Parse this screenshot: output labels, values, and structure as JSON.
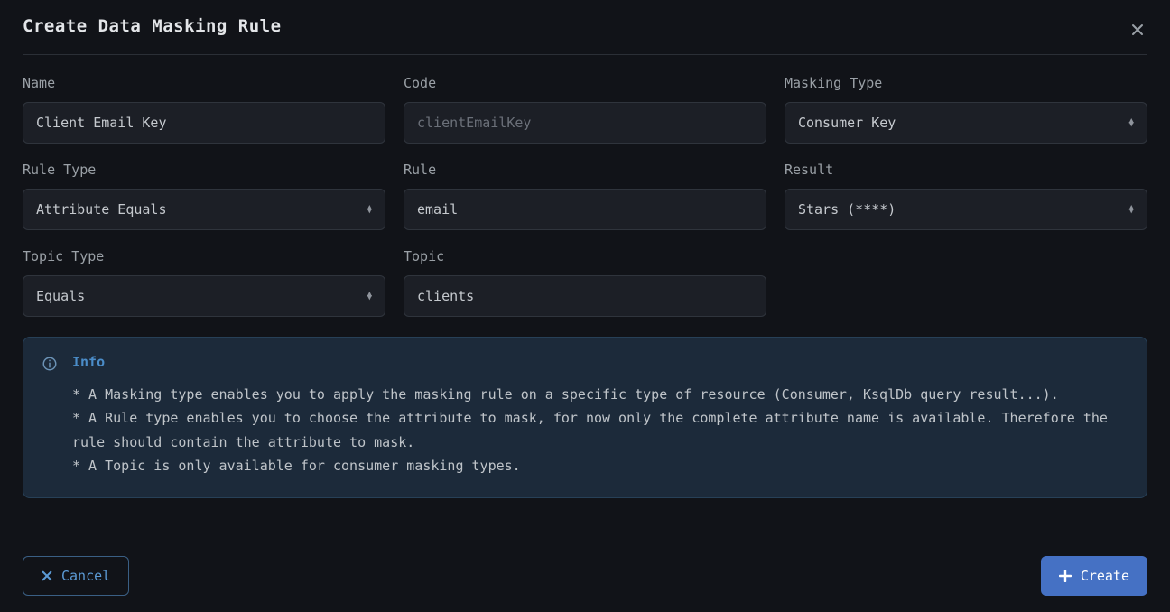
{
  "modal": {
    "title": "Create Data Masking Rule"
  },
  "fields": {
    "name": {
      "label": "Name",
      "value": "Client Email Key"
    },
    "code": {
      "label": "Code",
      "placeholder": "clientEmailKey",
      "value": ""
    },
    "maskingType": {
      "label": "Masking Type",
      "value": "Consumer Key"
    },
    "ruleType": {
      "label": "Rule Type",
      "value": "Attribute Equals"
    },
    "rule": {
      "label": "Rule",
      "value": "email"
    },
    "result": {
      "label": "Result",
      "value": "Stars (****)"
    },
    "topicType": {
      "label": "Topic Type",
      "value": "Equals"
    },
    "topic": {
      "label": "Topic",
      "value": "clients"
    }
  },
  "info": {
    "title": "Info",
    "body": "* A Masking type enables you to apply the masking rule on a specific type of resource (Consumer, KsqlDb query result...).\n* A Rule type enables you to choose the attribute to mask, for now only the complete attribute name is available. Therefore the rule should contain the attribute to mask.\n* A Topic is only available for consumer masking types."
  },
  "buttons": {
    "cancel": "Cancel",
    "create": "Create"
  }
}
